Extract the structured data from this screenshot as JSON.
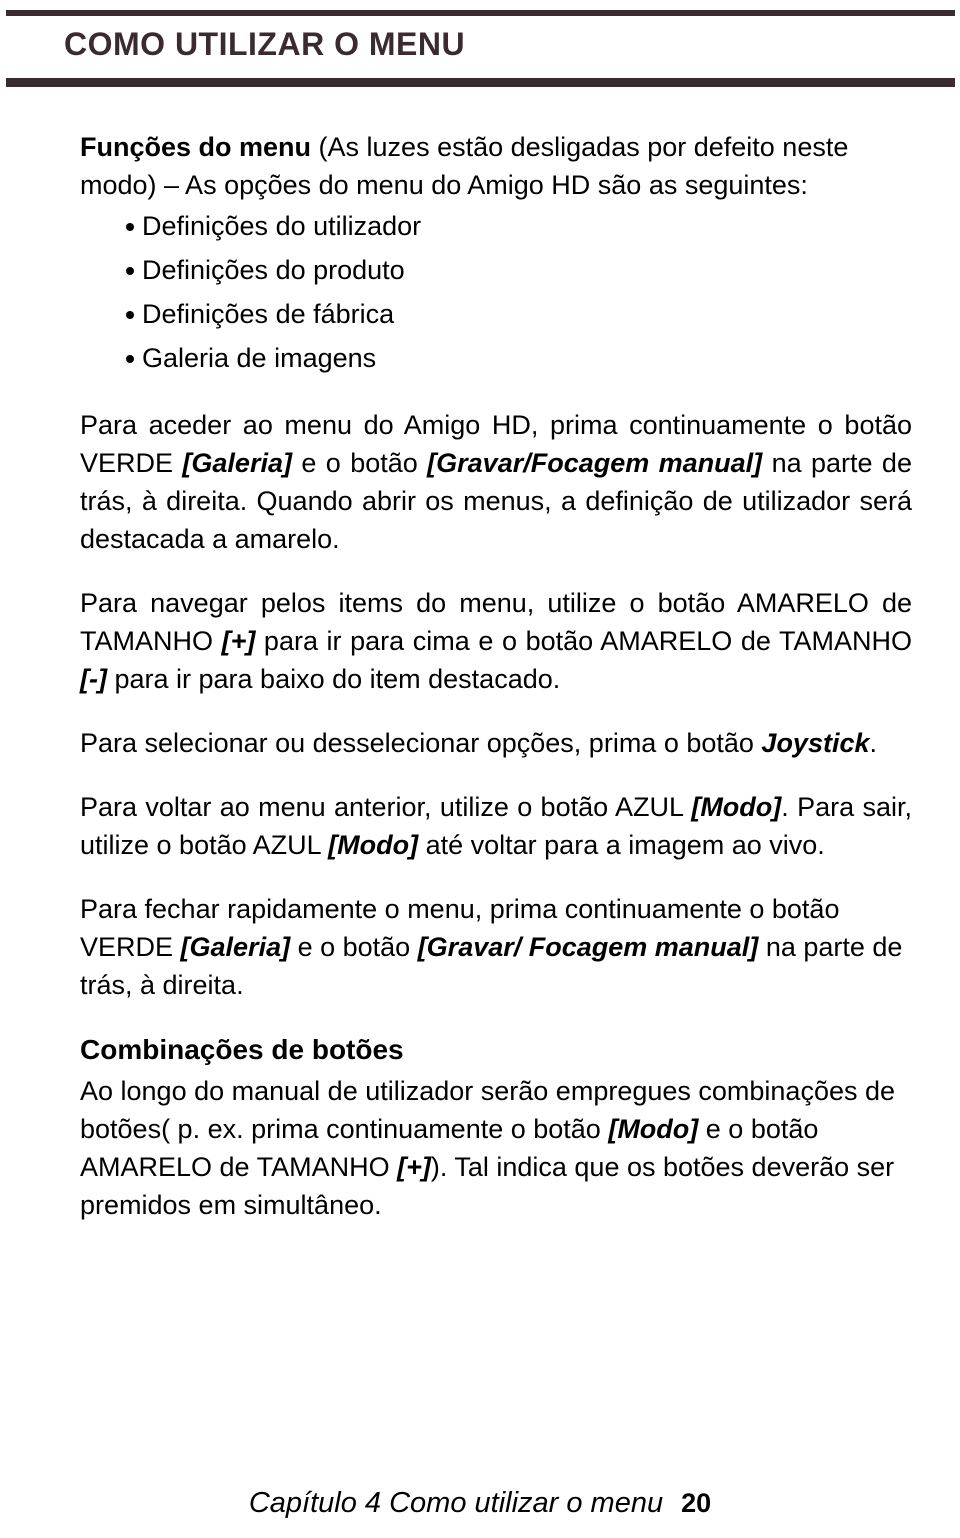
{
  "document": {
    "title": "COMO UTILIZAR O MENU",
    "accent_color": "#3b2b31",
    "text_color": "#000000",
    "background_color": "#ffffff"
  },
  "intro": {
    "lead_bold": "Funções do menu",
    "rest": " (As luzes estão desligadas por defeito neste modo) – As opções do menu do Amigo HD são as seguintes:"
  },
  "menu_options": [
    {
      "label": "Definições do utilizador"
    },
    {
      "label": "Definições do produto"
    },
    {
      "label": "Definições de fábrica"
    },
    {
      "label": "Galeria de imagens"
    }
  ],
  "paragraphs": {
    "access": {
      "part1": "Para aceder ao menu do Amigo HD, prima continuamente o botão VERDE ",
      "btn_galeria": "[Galeria]",
      "part2": " e o botão ",
      "btn_gravar": "[Gravar/Focagem manual]",
      "part3": " na parte de trás, à direita. Quando abrir os menus, a definição de utilizador será destacada a amarelo."
    },
    "navigate": {
      "part1": "Para navegar pelos items do menu, utilize o botão AMARELO de TAMANHO ",
      "btn_plus": "[+]",
      "part2": " para ir para cima e o botão AMARELO de TAMANHO ",
      "btn_minus": "[-]",
      "part3": " para ir para baixo do item destacado."
    },
    "select": {
      "part1": "Para selecionar ou desselecionar opções, prima o botão ",
      "btn_joystick": "Joystick",
      "part2": "."
    },
    "back_exit": {
      "part1": "Para voltar ao menu anterior, utilize o botão AZUL ",
      "btn_modo_1": "[Modo]",
      "part2": ". Para sair, utilize o botão AZUL ",
      "btn_modo_2": "[Modo]",
      "part3": " até voltar para a imagem ao vivo."
    },
    "close_fast": {
      "part1": "Para fechar rapidamente o menu, prima continuamente o botão VERDE ",
      "btn_galeria": "[Galeria]",
      "part2": " e o botão ",
      "btn_gravar": "[Gravar/ Focagem manual]",
      "part3": " na parte de trás, à direita."
    }
  },
  "combinations": {
    "heading": "Combinações de botões",
    "part1": "Ao longo do manual de utilizador serão empregues combinações de botões( p. ex. prima continuamente o botão ",
    "btn_modo": "[Modo]",
    "part2": " e o botão AMARELO de TAMANHO ",
    "btn_plus": "[+]",
    "part3": "). Tal indica que os botões deverão ser premidos em simultâneo."
  },
  "footer": {
    "chapter": "Capítulo 4 Como utilizar o menu",
    "page_number": "20"
  }
}
